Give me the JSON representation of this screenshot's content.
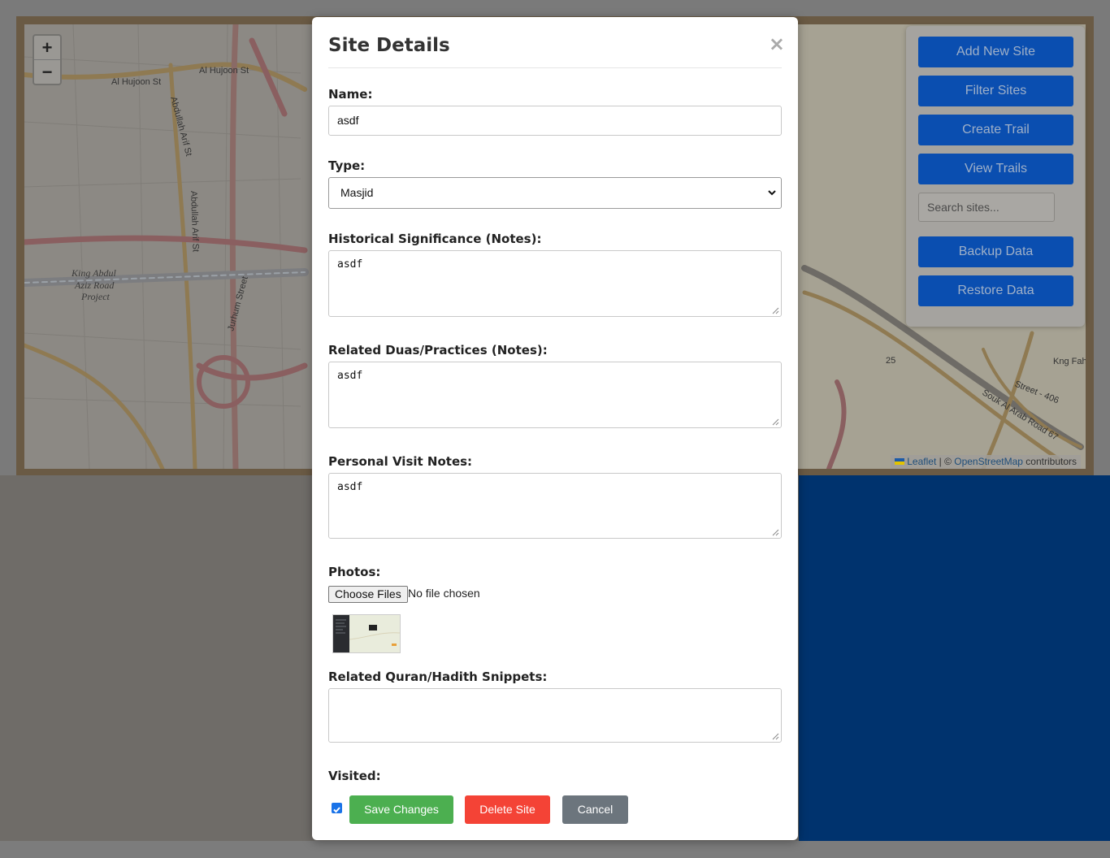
{
  "map": {
    "zoom_in": "+",
    "zoom_out": "−",
    "attribution": {
      "leaflet": "Leaflet",
      "separator": " | © ",
      "osm": "OpenStreetMap",
      "suffix": " contributors"
    },
    "labels": {
      "hujoon_1": "Al Hujoon St",
      "hujoon_2": "Al Hujoon St",
      "abdullah_arif_1": "Abdullah Arif St",
      "abdullah_arif_2": "Abdullah Arif St",
      "jurhum": "Jurhum Street",
      "king_abdul_aziz_1": "King Abdul",
      "king_abdul_aziz_2": "Aziz Road",
      "king_abdul_aziz_3": "Project",
      "king_fahd": "Kng Fahd",
      "souk_al_arab": "Souk Al Arab Road 67",
      "street_406": "Street - 406",
      "road_25": "25"
    }
  },
  "control_panel": {
    "buttons": [
      "Add New Site",
      "Filter Sites",
      "Create Trail",
      "View Trails",
      "Backup Data",
      "Restore Data"
    ],
    "search_placeholder": "Search sites..."
  },
  "modal": {
    "title": "Site Details",
    "close": "×",
    "fields": {
      "name_label": "Name:",
      "name_value": "asdf",
      "type_label": "Type:",
      "type_value": "Masjid",
      "historical_label": "Historical Significance (Notes):",
      "historical_value": "asdf",
      "duas_label": "Related Duas/Practices (Notes):",
      "duas_value": "asdf",
      "personal_label": "Personal Visit Notes:",
      "personal_value": "asdf",
      "photos_label": "Photos:",
      "choose_files": "Choose Files",
      "file_status": "No file chosen",
      "quran_label": "Related Quran/Hadith Snippets:",
      "quran_value": "",
      "visited_label": "Visited:"
    },
    "buttons": {
      "save": "Save Changes",
      "delete": "Delete Site",
      "cancel": "Cancel"
    },
    "colors": {
      "save": "#4caf50",
      "delete": "#f44336",
      "cancel": "#6c757d"
    }
  }
}
